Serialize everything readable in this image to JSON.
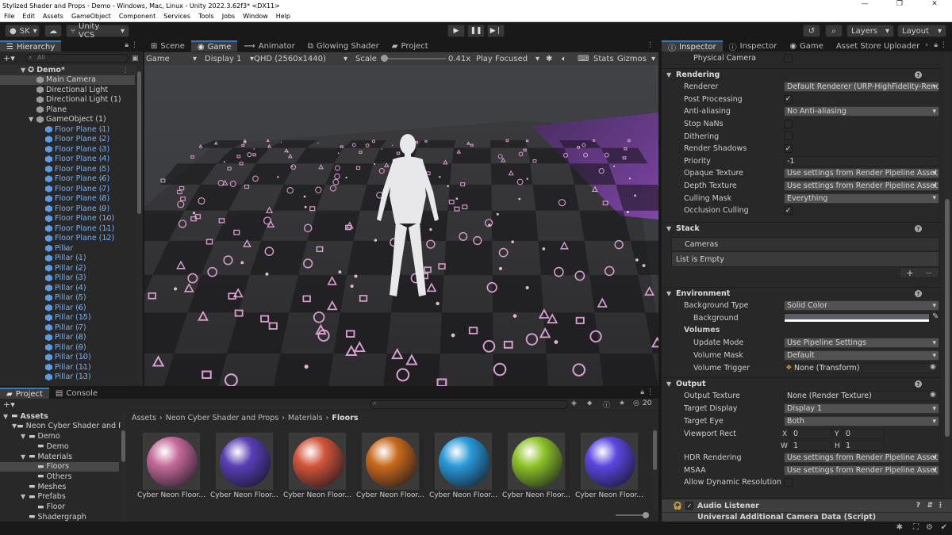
{
  "window": {
    "title": "Stylized Shader and Props - Demo - Windows, Mac, Linux - Unity 2022.3.62f3* <DX11>"
  },
  "menu": [
    "File",
    "Edit",
    "Assets",
    "GameObject",
    "Component",
    "Services",
    "Tools",
    "Jobs",
    "Window",
    "Help"
  ],
  "toolbar": {
    "account": "SK",
    "vcs": "Unity VCS",
    "layers": "Layers",
    "layout": "Layout"
  },
  "hierarchy": {
    "tab": "Hierarchy",
    "search_placeholder": "All",
    "scene": "Demo*",
    "items": [
      {
        "label": "Main Camera",
        "icon": "gray",
        "indent": 1,
        "selected": true
      },
      {
        "label": "Directional Light",
        "icon": "gray",
        "indent": 1
      },
      {
        "label": "Directional Light (1)",
        "icon": "gray",
        "indent": 1
      },
      {
        "label": "Plane",
        "icon": "gray",
        "indent": 1
      },
      {
        "label": "GameObject (1)",
        "icon": "gray",
        "indent": 1,
        "expanded": true
      },
      {
        "label": "Floor Plane (1)",
        "icon": "blue",
        "indent": 2,
        "prefab": true
      },
      {
        "label": "Floor Plane (2)",
        "icon": "blue",
        "indent": 2,
        "prefab": true
      },
      {
        "label": "Floor Plane (3)",
        "icon": "blue",
        "indent": 2,
        "prefab": true
      },
      {
        "label": "Floor Plane (4)",
        "icon": "blue",
        "indent": 2,
        "prefab": true
      },
      {
        "label": "Floor Plane (5)",
        "icon": "blue",
        "indent": 2,
        "prefab": true
      },
      {
        "label": "Floor Plane (6)",
        "icon": "blue",
        "indent": 2,
        "prefab": true
      },
      {
        "label": "Floor Plane (7)",
        "icon": "blue",
        "indent": 2,
        "prefab": true
      },
      {
        "label": "Floor Plane (8)",
        "icon": "blue",
        "indent": 2,
        "prefab": true
      },
      {
        "label": "Floor Plane (9)",
        "icon": "blue",
        "indent": 2,
        "prefab": true
      },
      {
        "label": "Floor Plane (10)",
        "icon": "blue",
        "indent": 2,
        "prefab": true
      },
      {
        "label": "Floor Plane (11)",
        "icon": "blue",
        "indent": 2,
        "prefab": true
      },
      {
        "label": "Floor Plane (12)",
        "icon": "blue",
        "indent": 2,
        "prefab": true
      },
      {
        "label": "Pillar",
        "icon": "blue",
        "indent": 2,
        "prefab": true
      },
      {
        "label": "Pillar (1)",
        "icon": "blue",
        "indent": 2,
        "prefab": true
      },
      {
        "label": "Pillar (2)",
        "icon": "blue",
        "indent": 2,
        "prefab": true
      },
      {
        "label": "Pillar (3)",
        "icon": "blue",
        "indent": 2,
        "prefab": true
      },
      {
        "label": "Pillar (4)",
        "icon": "blue",
        "indent": 2,
        "prefab": true
      },
      {
        "label": "Pillar (5)",
        "icon": "blue",
        "indent": 2,
        "prefab": true
      },
      {
        "label": "Pillar (6)",
        "icon": "blue",
        "indent": 2,
        "prefab": true
      },
      {
        "label": "Pillar (15)",
        "icon": "blue",
        "indent": 2,
        "prefab": true
      },
      {
        "label": "Pillar (7)",
        "icon": "blue",
        "indent": 2,
        "prefab": true
      },
      {
        "label": "Pillar (8)",
        "icon": "blue",
        "indent": 2,
        "prefab": true
      },
      {
        "label": "Pillar (9)",
        "icon": "blue",
        "indent": 2,
        "prefab": true
      },
      {
        "label": "Pillar (10)",
        "icon": "blue",
        "indent": 2,
        "prefab": true
      },
      {
        "label": "Pillar (11)",
        "icon": "blue",
        "indent": 2,
        "prefab": true
      },
      {
        "label": "Pillar (13)",
        "icon": "blue",
        "indent": 2,
        "prefab": true
      }
    ]
  },
  "center_tabs": [
    "Scene",
    "Game",
    "Animator",
    "Glowing Shader",
    "Project"
  ],
  "game_bar": {
    "mode": "Game",
    "display": "Display 1",
    "resolution": "QHD (2560x1440)",
    "scale_label": "Scale",
    "scale_value": "0.41x",
    "play_focused": "Play Focused",
    "stats": "Stats",
    "gizmos": "Gizmos",
    "scale_fraction": 0.05
  },
  "project": {
    "tabs": [
      "Project",
      "Console"
    ],
    "tree": [
      {
        "label": "Assets",
        "indent": 0,
        "bold": true
      },
      {
        "label": "Neon Cyber Shader and P",
        "indent": 1
      },
      {
        "label": "Demo",
        "indent": 2
      },
      {
        "label": "Demo",
        "indent": 3
      },
      {
        "label": "Materials",
        "indent": 2
      },
      {
        "label": "Floors",
        "indent": 3,
        "selected": true
      },
      {
        "label": "Others",
        "indent": 3
      },
      {
        "label": "Meshes",
        "indent": 2
      },
      {
        "label": "Prefabs",
        "indent": 2
      },
      {
        "label": "Floor",
        "indent": 3
      },
      {
        "label": "Shadergraph",
        "indent": 2
      }
    ],
    "breadcrumb": [
      "Assets",
      "Neon Cyber Shader and Props",
      "Materials",
      "Floors"
    ],
    "count": "20",
    "assets": [
      {
        "label": "Cyber Neon Floor...",
        "color": "#c46a9a"
      },
      {
        "label": "Cyber Neon Floor...",
        "color": "#5a3fb5"
      },
      {
        "label": "Cyber Neon Floor...",
        "color": "#d2553a"
      },
      {
        "label": "Cyber Neon Floor...",
        "color": "#c96a1e"
      },
      {
        "label": "Cyber Neon Floor...",
        "color": "#2a9ad9"
      },
      {
        "label": "Cyber Neon Floor...",
        "color": "#8fc42a"
      },
      {
        "label": "Cyber Neon Floor...",
        "color": "#5a48e0"
      }
    ]
  },
  "inspector": {
    "tabs": [
      "Inspector",
      "Inspector",
      "Game",
      "Asset Store Uploader"
    ],
    "physical_camera": "Physical Camera",
    "rendering": {
      "title": "Rendering",
      "rows": [
        {
          "label": "Renderer",
          "value": "Default Renderer (URP-HighFidelity-Rende",
          "type": "dropdown"
        },
        {
          "label": "Post Processing",
          "value": "✓",
          "type": "check"
        },
        {
          "label": "Anti-aliasing",
          "value": "No Anti-aliasing",
          "type": "dropdown"
        },
        {
          "label": "Stop NaNs",
          "value": "",
          "type": "check"
        },
        {
          "label": "Dithering",
          "value": "",
          "type": "check"
        },
        {
          "label": "Render Shadows",
          "value": "✓",
          "type": "check"
        },
        {
          "label": "Priority",
          "value": "-1",
          "type": "field"
        },
        {
          "label": "Opaque Texture",
          "value": "Use settings from Render Pipeline Asset",
          "type": "dropdown"
        },
        {
          "label": "Depth Texture",
          "value": "Use settings from Render Pipeline Asset",
          "type": "dropdown"
        },
        {
          "label": "Culling Mask",
          "value": "Everything",
          "type": "dropdown"
        },
        {
          "label": "Occlusion Culling",
          "value": "✓",
          "type": "check"
        }
      ]
    },
    "stack": {
      "title": "Stack",
      "header": "Cameras",
      "empty": "List is Empty",
      "add": "+",
      "remove": "−"
    },
    "environment": {
      "title": "Environment",
      "background_type_label": "Background Type",
      "background_type": "Solid Color",
      "background_label": "Background",
      "volumes": "Volumes",
      "update_mode_label": "Update Mode",
      "update_mode": "Use Pipeline Settings",
      "volume_mask_label": "Volume Mask",
      "volume_mask": "Default",
      "volume_trigger_label": "Volume Trigger",
      "volume_trigger": "None (Transform)"
    },
    "output": {
      "title": "Output",
      "output_texture_label": "Output Texture",
      "output_texture": "None (Render Texture)",
      "target_display_label": "Target Display",
      "target_display": "Display 1",
      "target_eye_label": "Target Eye",
      "target_eye": "Both",
      "viewport_label": "Viewport Rect",
      "vx": "0",
      "vy": "0",
      "vw": "1",
      "vh": "1",
      "hdr_label": "HDR Rendering",
      "hdr": "Use settings from Render Pipeline Asset",
      "msaa_label": "MSAA",
      "msaa": "Use settings from Render Pipeline Asset",
      "dyn_res_label": "Allow Dynamic Resolution"
    },
    "audio_listener": "Audio Listener",
    "universal_data": "Universal Additional Camera Data (Script)"
  },
  "colors": {
    "accent": "#3a79bb",
    "panel": "#282828",
    "dark": "#191919",
    "prefab": "#7cb0f0",
    "neon": "#f0a0e0"
  }
}
